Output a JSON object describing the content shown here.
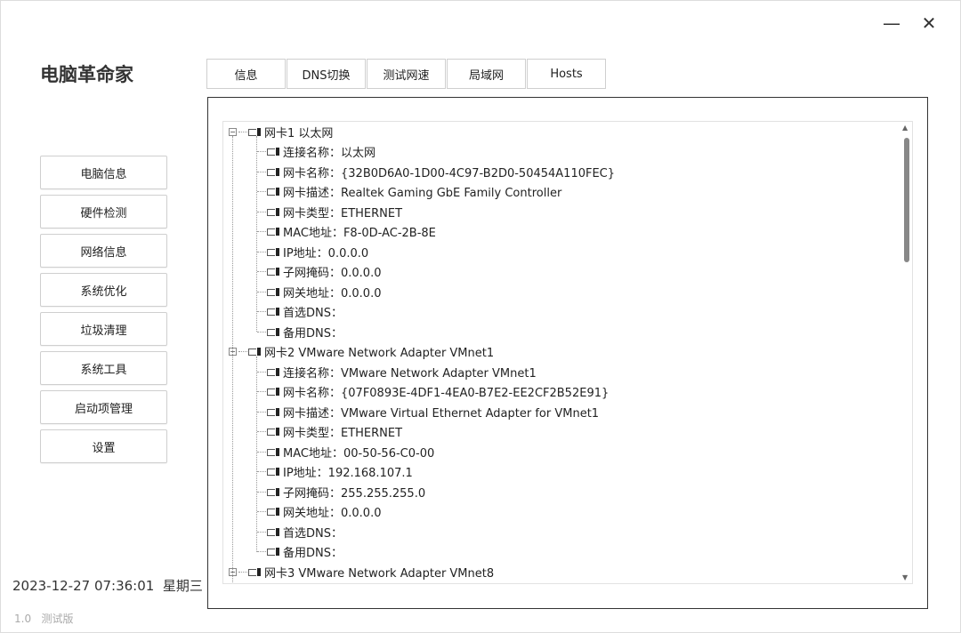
{
  "window": {
    "title": "电脑革命家",
    "minimize_icon": "minimize-icon",
    "close_icon": "close-icon"
  },
  "sidebar": {
    "items": [
      {
        "label": "电脑信息"
      },
      {
        "label": "硬件检测"
      },
      {
        "label": "网络信息"
      },
      {
        "label": "系统优化"
      },
      {
        "label": "垃圾清理"
      },
      {
        "label": "系统工具"
      },
      {
        "label": "启动项管理"
      },
      {
        "label": "设置"
      }
    ]
  },
  "tabs": [
    {
      "label": "信息"
    },
    {
      "label": "DNS切换"
    },
    {
      "label": "测试网速"
    },
    {
      "label": "局域网"
    },
    {
      "label": "Hosts"
    }
  ],
  "tree": [
    {
      "label": "网卡1 以太网",
      "children": [
        "连接名称：以太网",
        "网卡名称：{32B0D6A0-1D00-4C97-B2D0-50454A110FEC}",
        "网卡描述：Realtek Gaming GbE Family Controller",
        "网卡类型：ETHERNET",
        "MAC地址：F8-0D-AC-2B-8E",
        "IP地址：0.0.0.0",
        "子网掩码：0.0.0.0",
        "网关地址：0.0.0.0",
        "首选DNS：",
        "备用DNS："
      ]
    },
    {
      "label": "网卡2 VMware Network Adapter VMnet1",
      "children": [
        "连接名称：VMware Network Adapter VMnet1",
        "网卡名称：{07F0893E-4DF1-4EA0-B7E2-EE2CF2B52E91}",
        "网卡描述：VMware Virtual Ethernet Adapter for VMnet1",
        "网卡类型：ETHERNET",
        "MAC地址：00-50-56-C0-00",
        "IP地址：192.168.107.1",
        "子网掩码：255.255.255.0",
        "网关地址：0.0.0.0",
        "首选DNS：",
        "备用DNS："
      ]
    },
    {
      "label": "网卡3 VMware Network Adapter VMnet8",
      "children": []
    }
  ],
  "status": {
    "datetime": "2023-12-27 07:36:01",
    "weekday": "星期三",
    "version": "1.0",
    "edition": "测试版"
  }
}
